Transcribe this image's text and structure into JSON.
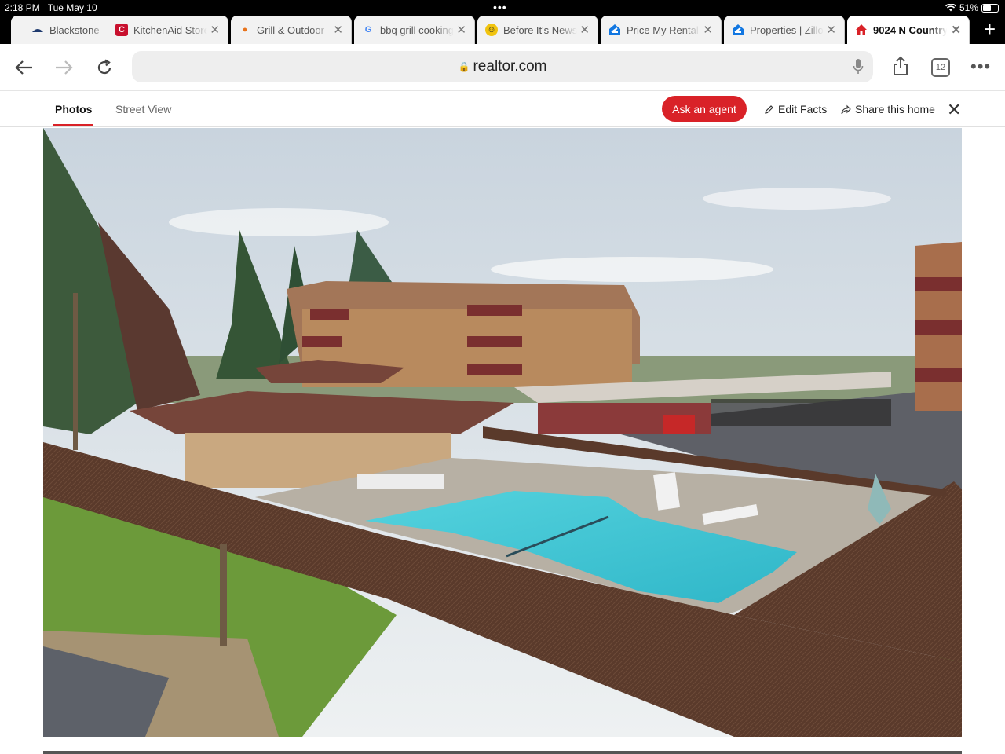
{
  "status": {
    "time": "2:18 PM",
    "date": "Tue May 10",
    "battery": "51%",
    "battery_level": 0.51
  },
  "tabs": [
    {
      "title": "Blackstone",
      "icon": "blackstone-icon",
      "active": false
    },
    {
      "title": "KitchenAid Store",
      "icon": "kitchenaid-icon",
      "active": false
    },
    {
      "title": "Grill & Outdoor",
      "icon": "grill-icon",
      "active": false
    },
    {
      "title": "bbq grill cooking",
      "icon": "google-icon",
      "active": false
    },
    {
      "title": "Before It's News",
      "icon": "news-icon",
      "active": false
    },
    {
      "title": "Price My Rental",
      "icon": "zillow-icon",
      "active": false
    },
    {
      "title": "Properties | Zillow",
      "icon": "zillow-icon",
      "active": false
    },
    {
      "title": "9024 N Country",
      "icon": "realtor-icon",
      "active": true
    }
  ],
  "toolbar": {
    "url": "realtor.com",
    "tab_count": "12"
  },
  "page_header": {
    "tabs": [
      "Photos",
      "Street View"
    ],
    "ask_agent": "Ask an agent",
    "edit_facts": "Edit Facts",
    "share_home": "Share this home"
  },
  "colors": {
    "accent": "#d92228",
    "sky": "#dfe6ec",
    "pool": "#3fc9d6",
    "fence": "#5b3b2c",
    "grass": "#6c9a3a"
  },
  "photo": {
    "alt_subject": "apartment-complex-pool-photo"
  }
}
